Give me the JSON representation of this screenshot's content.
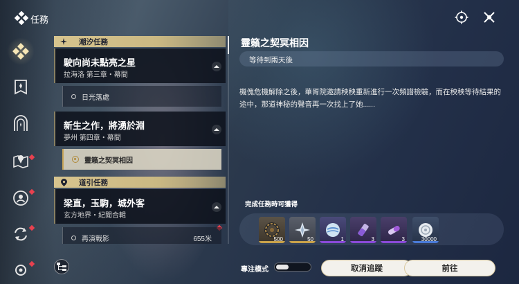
{
  "header": {
    "title": "任務",
    "icons": [
      "quest-diamond-icon",
      "map-target-icon",
      "close-icon"
    ]
  },
  "sidebar": {
    "items": [
      {
        "icon": "quest-diamond-icon",
        "active": true,
        "notification": false
      },
      {
        "icon": "bookmark-shield-icon",
        "active": false,
        "notification": false
      },
      {
        "icon": "arch-star-icon",
        "active": false,
        "notification": false
      },
      {
        "icon": "map-pin-icon",
        "active": false,
        "notification": true
      },
      {
        "icon": "profile-ring-icon",
        "active": false,
        "notification": true
      },
      {
        "icon": "cycle-arrows-icon",
        "active": false,
        "notification": true
      },
      {
        "icon": "gear-icon",
        "active": false,
        "notification": false
      }
    ]
  },
  "quest_list": {
    "categories": [
      {
        "name": "潮汐任務",
        "icon": "sparkle-icon",
        "quests": [
          {
            "title": "駛向尚未點亮之星",
            "subtitle": "拉海洛 第三章・幕間",
            "steps": [
              {
                "label": "日光落處",
                "active": false
              }
            ]
          },
          {
            "title": "新生之作，將湧於淵",
            "subtitle": "夢州 第四章・幕間",
            "steps": [
              {
                "label": "靈籟之契冥相因",
                "active": true
              }
            ]
          }
        ]
      },
      {
        "name": "道引任務",
        "icon": "location-pin-icon",
        "quests": [
          {
            "title": "梁直，玉駒，城外客",
            "subtitle": "玄方地界・紀聞合輯",
            "steps": [
              {
                "label": "再演戰影",
                "active": false,
                "distance": "655米"
              }
            ]
          }
        ]
      }
    ]
  },
  "detail": {
    "title": "靈籟之契冥相因",
    "status": "等待到兩天後",
    "description": "機傀危機解除之後，華胥院邀請秧秧重新進行一次頻譜檢驗，而在秧秧等待結果的途中，那道神秘的聲音再一次找上了她......"
  },
  "rewards": {
    "label": "完成任務時可獲得",
    "items": [
      {
        "icon": "gear-cog-icon",
        "qty": "500",
        "rarity_color": "#c9a24a"
      },
      {
        "icon": "crystal-shard-icon",
        "qty": "50",
        "rarity_color": "#c9a24a"
      },
      {
        "icon": "energy-orb-icon",
        "qty": "1",
        "rarity_color": "#8a4ad8"
      },
      {
        "icon": "potion-vial-icon",
        "qty": "3",
        "rarity_color": "#8a4ad8"
      },
      {
        "icon": "capsule-icon",
        "qty": "3",
        "rarity_color": "#8a4ad8"
      },
      {
        "icon": "shell-coin-icon",
        "qty": "30000",
        "rarity_color": "#4a7bd8"
      }
    ]
  },
  "footer": {
    "focus_label": "專注模式",
    "focus_enabled": false,
    "cancel_label": "取消追蹤",
    "go_label": "前往"
  }
}
